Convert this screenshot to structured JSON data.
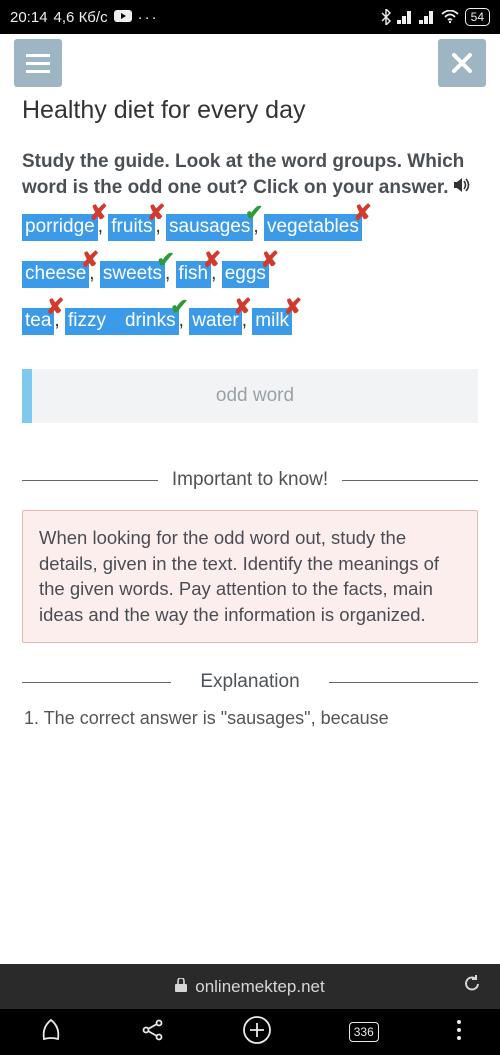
{
  "status": {
    "time": "20:14",
    "speed": "4,6 Кб/с",
    "battery": "54"
  },
  "header": {
    "title": "Healthy diet for every day"
  },
  "task": {
    "instructions": "Study the guide. Look at the word groups. Which word is the odd one out? Click on your answer.",
    "rows": [
      [
        {
          "text": "porridge",
          "result": "wrong"
        },
        {
          "text": "fruits",
          "result": "wrong"
        },
        {
          "text": "sausages",
          "result": "correct"
        },
        {
          "text": "vegetables",
          "result": "wrong"
        }
      ],
      [
        {
          "text": "cheese",
          "result": "wrong"
        },
        {
          "text": "sweets",
          "result": "correct"
        },
        {
          "text": "fish",
          "result": "wrong"
        },
        {
          "text": "eggs",
          "result": "wrong"
        }
      ],
      [
        {
          "text": "tea",
          "result": "wrong"
        },
        {
          "text": "fizzy drinks",
          "result": "correct"
        },
        {
          "text": "water",
          "result": "wrong"
        },
        {
          "text": "milk",
          "result": "wrong"
        }
      ]
    ],
    "odd_placeholder": "odd word"
  },
  "sections": {
    "important_label": "Important to know!",
    "important_text": "When looking for the odd word out, study the details, given in the text. Identify the meanings of the given words. Pay attention to the facts, main ideas and the way the information is organized.",
    "explanation_label": "Explanation",
    "explanation_preview": "1. The correct answer is \"sausages\", because"
  },
  "browser": {
    "url": "onlinemektep.net",
    "tabs": "336"
  }
}
